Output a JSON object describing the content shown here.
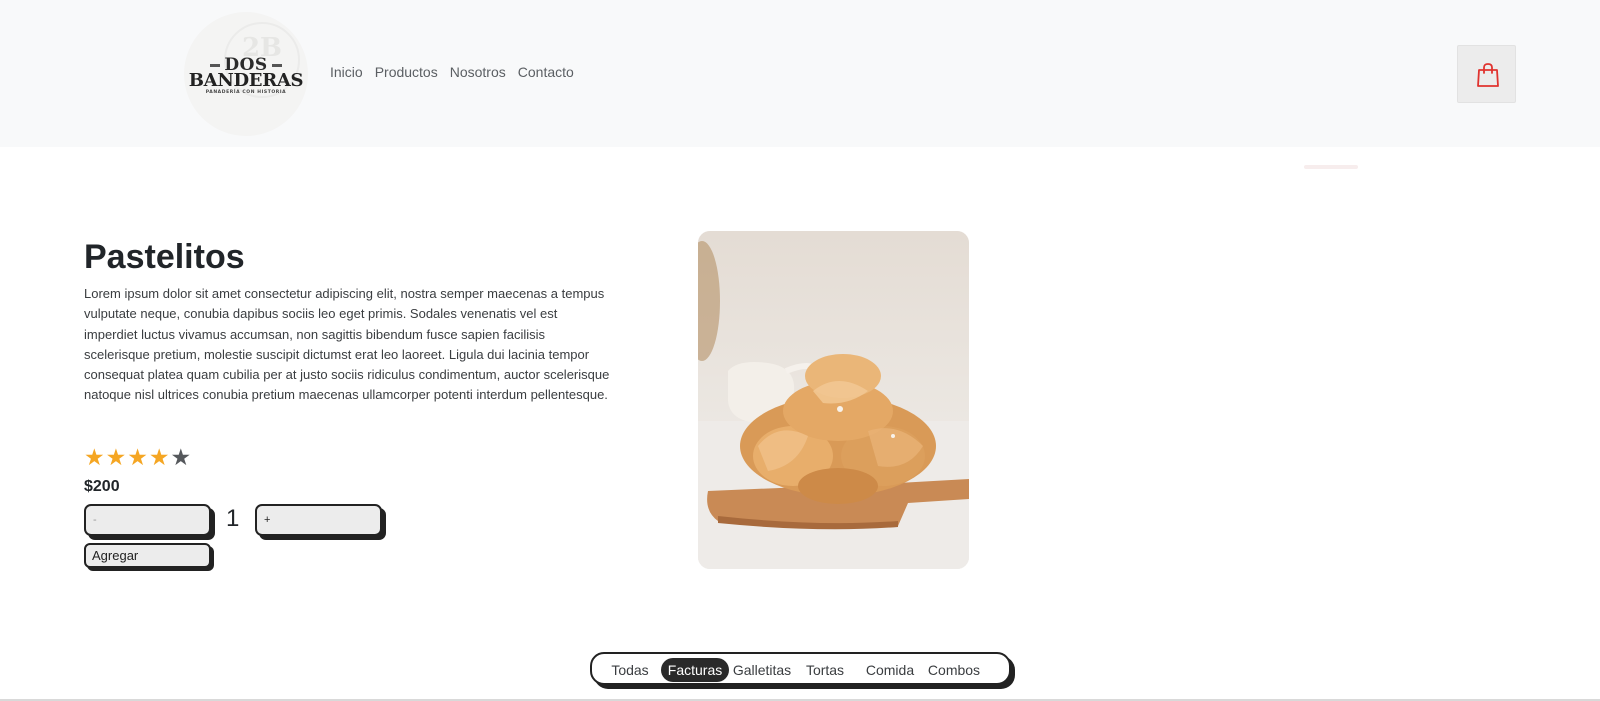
{
  "header": {
    "logo": {
      "monogram": "2B",
      "line1": "DOS",
      "line2": "BANDERAS",
      "tagline": "PANADERÍA CON HISTORIA"
    },
    "nav": [
      {
        "label": "Inicio"
      },
      {
        "label": "Productos"
      },
      {
        "label": "Nosotros"
      },
      {
        "label": "Contacto"
      }
    ],
    "cart_icon": "shopping-bag-icon"
  },
  "product": {
    "title": "Pastelitos",
    "description": "Lorem ipsum dolor sit amet consectetur adipiscing elit, nostra semper maecenas a tempus vulputate neque, conubia dapibus sociis leo eget primis. Sodales venenatis vel est imperdiet luctus vivamus accumsan, non sagittis bibendum fusce sapien facilisis scelerisque pretium, molestie suscipit dictumst erat leo laoreet. Ligula dui lacinia tempor consequat platea quam cubilia per at justo sociis ridiculus condimentum, auctor scelerisque natoque nisl ultrices conubia pretium maecenas ullamcorper potenti interdum pellentesque.",
    "rating": 4,
    "rating_max": 5,
    "star_glyph": "★",
    "price": "$200",
    "qty_minus_label": "-",
    "qty_plus_label": "+",
    "quantity": "1",
    "add_label": "Agregar"
  },
  "categories": {
    "tabs": [
      {
        "label": "Todas",
        "active": false
      },
      {
        "label": "Facturas",
        "active": true
      },
      {
        "label": "Galletitas",
        "active": false
      },
      {
        "label": "Tortas",
        "active": false
      },
      {
        "label": "Comida",
        "active": false
      },
      {
        "label": "Combos",
        "active": false
      }
    ]
  },
  "colors": {
    "star_on": "#f5a623",
    "star_off": "#55585c",
    "cart_icon": "#e0332f",
    "tab_active_bg": "#2a2a2a"
  }
}
